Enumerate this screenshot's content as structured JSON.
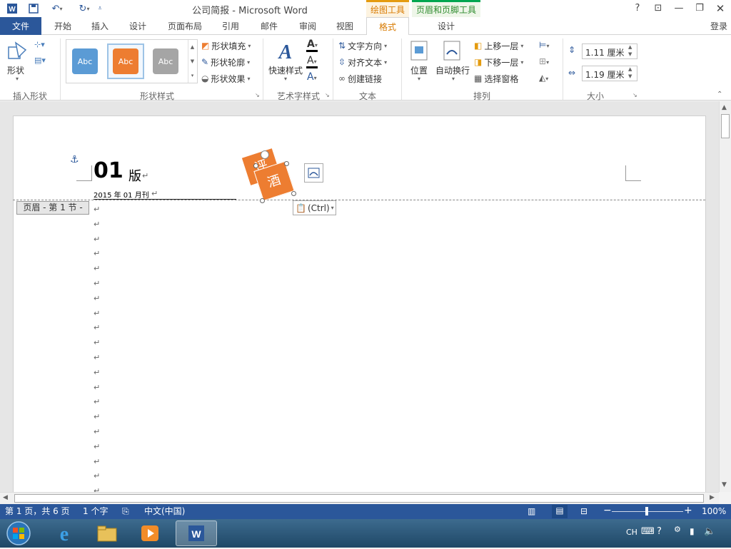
{
  "window": {
    "title": "公司简报 - Microsoft Word",
    "context_draw_header": "绘图工具",
    "context_hf_header": "页眉和页脚工具",
    "help": "?",
    "login": "登录"
  },
  "tabs": [
    "文件",
    "开始",
    "插入",
    "设计",
    "页面布局",
    "引用",
    "邮件",
    "审阅",
    "视图",
    "格式",
    "设计"
  ],
  "ribbon": {
    "insert_shape": {
      "label": "形状",
      "group": "插入形状"
    },
    "shape_styles": {
      "group": "形状样式",
      "preset_text": "Abc",
      "fill": "形状填充",
      "outline": "形状轮廓",
      "effects": "形状效果"
    },
    "art_text": {
      "quick_styles": "快速样式",
      "group": "艺术字样式"
    },
    "text": {
      "direction": "文字方向",
      "align": "对齐文本",
      "link": "创建链接",
      "group": "文本"
    },
    "arrange": {
      "position": "位置",
      "wrap": "自动换行",
      "forward": "上移一层",
      "backward": "下移一层",
      "selection_pane": "选择窗格",
      "group": "排列"
    },
    "size": {
      "height": "1.11 厘米",
      "width": "1.19 厘米",
      "group": "大小"
    }
  },
  "document": {
    "heading_number": "01",
    "heading_suffix": "版",
    "date_line": "2015 年 01 月刊",
    "header_tag": "页眉 - 第 1 节 -",
    "shape_text_1": "评",
    "shape_text_2": "酒",
    "paste_options": "(Ctrl)",
    "para_mark": "↵"
  },
  "status": {
    "page": "第 1 页，共 6 页",
    "words": "1 个字",
    "language": "中文(中国)",
    "zoom": "100%"
  },
  "taskbar": {
    "lang": "CH"
  },
  "colors": {
    "word_blue": "#2b579a",
    "orange": "#ed7d31",
    "hf_green": "#00a650",
    "draw_orange": "#e49b0f"
  }
}
